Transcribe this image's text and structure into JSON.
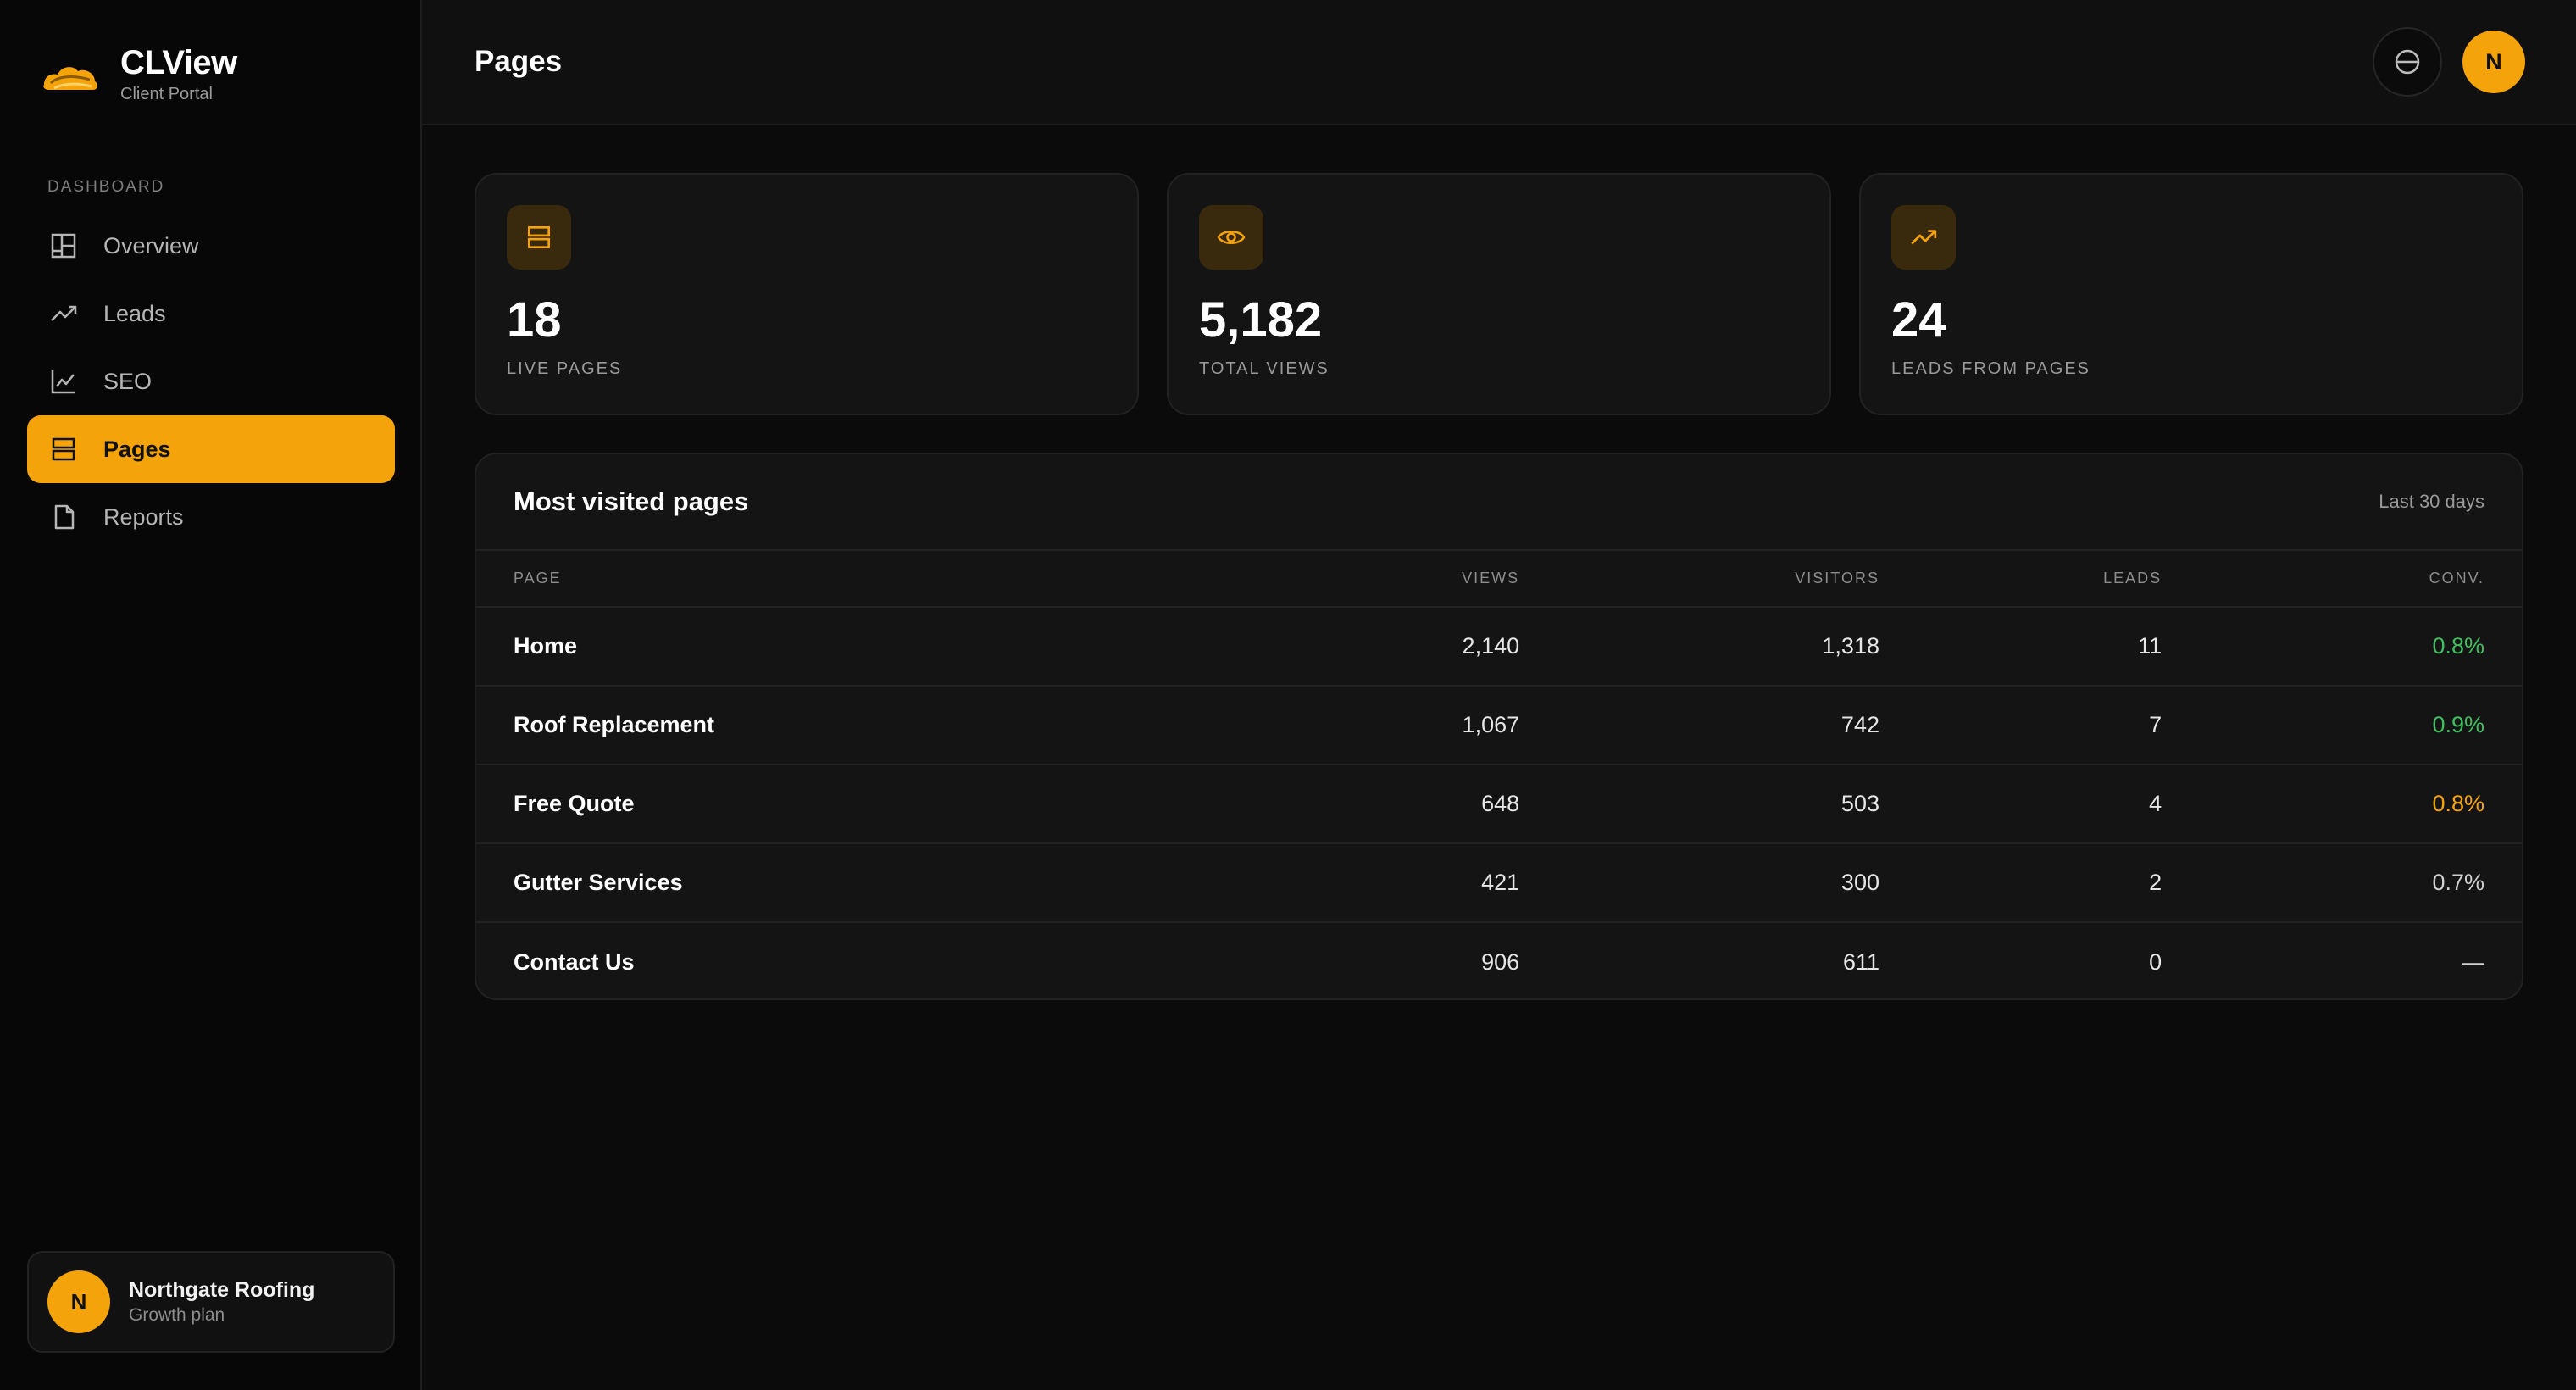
{
  "brand": {
    "name": "CLView",
    "subtitle": "Client Portal"
  },
  "sidebar": {
    "section_label": "DASHBOARD",
    "items": [
      {
        "label": "Overview",
        "icon": "layout-icon",
        "active": false
      },
      {
        "label": "Leads",
        "icon": "trending-up-icon",
        "active": false
      },
      {
        "label": "SEO",
        "icon": "line-chart-icon",
        "active": false
      },
      {
        "label": "Pages",
        "icon": "pages-icon",
        "active": true
      },
      {
        "label": "Reports",
        "icon": "document-icon",
        "active": false
      }
    ],
    "account": {
      "initial": "N",
      "name": "Northgate Roofing",
      "plan": "Growth plan"
    }
  },
  "header": {
    "title": "Pages",
    "theme_icon": "contrast-icon",
    "avatar_initial": "N"
  },
  "stats": [
    {
      "value": "18",
      "label": "LIVE PAGES",
      "icon": "pages-icon"
    },
    {
      "value": "5,182",
      "label": "TOTAL VIEWS",
      "icon": "eye-icon"
    },
    {
      "value": "24",
      "label": "LEADS FROM PAGES",
      "icon": "trending-up-icon"
    }
  ],
  "table": {
    "title": "Most visited pages",
    "range": "Last 30 days",
    "columns": [
      "PAGE",
      "VIEWS",
      "VISITORS",
      "LEADS",
      "CONV."
    ],
    "rows": [
      {
        "page": "Home",
        "views": "2,140",
        "visitors": "1,318",
        "leads": "11",
        "conv": "0.8%",
        "conv_status": "green"
      },
      {
        "page": "Roof Replacement",
        "views": "1,067",
        "visitors": "742",
        "leads": "7",
        "conv": "0.9%",
        "conv_status": "green"
      },
      {
        "page": "Free Quote",
        "views": "648",
        "visitors": "503",
        "leads": "4",
        "conv": "0.8%",
        "conv_status": "amber"
      },
      {
        "page": "Gutter Services",
        "views": "421",
        "visitors": "300",
        "leads": "2",
        "conv": "0.7%",
        "conv_status": "neutral"
      },
      {
        "page": "Contact Us",
        "views": "906",
        "visitors": "611",
        "leads": "0",
        "conv": "—",
        "conv_status": "neutral"
      }
    ]
  },
  "colors": {
    "accent": "#f5a30a",
    "positive": "#3fbf5f",
    "background": "#0b0b0b"
  }
}
